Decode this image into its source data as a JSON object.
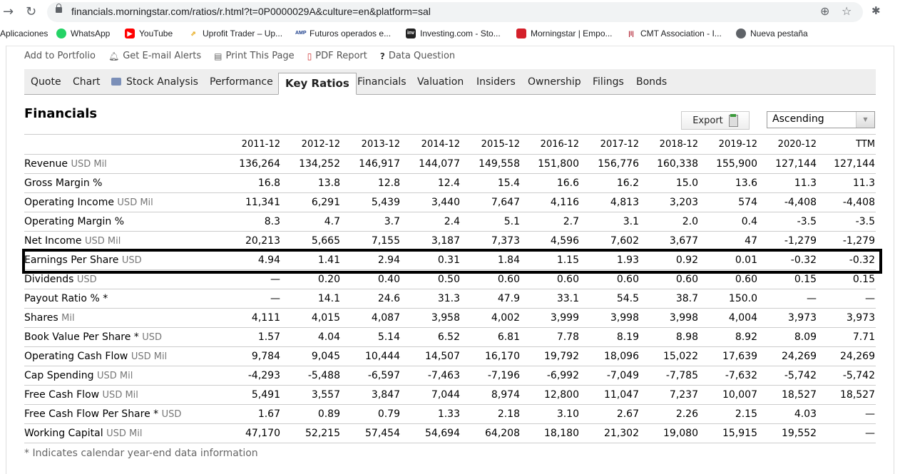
{
  "browser": {
    "url": "financials.morningstar.com/ratios/r.html?t=0P0000029A&culture=en&platform=sal",
    "bookmarks": [
      {
        "label": "Aplicaciones",
        "icon": "apps-icon"
      },
      {
        "label": "WhatsApp",
        "icon": "whatsapp-icon",
        "color": "#25d366"
      },
      {
        "label": "YouTube",
        "icon": "youtube-icon",
        "color": "#ff0000"
      },
      {
        "label": "Uprofit Trader – Up...",
        "icon": "uprofit-icon",
        "color": "#e6a817"
      },
      {
        "label": "Futuros operados e...",
        "icon": "amp-icon",
        "color": "#1d3f8c"
      },
      {
        "label": "Investing.com - Sto...",
        "icon": "investing-icon",
        "color": "#222222"
      },
      {
        "label": "Morningstar | Empo...",
        "icon": "morningstar-icon",
        "color": "#d4202a"
      },
      {
        "label": "CMT Association - I...",
        "icon": "cmt-icon",
        "color": "#b02030"
      },
      {
        "label": "Nueva pestaña",
        "icon": "globe-icon",
        "color": "#5f6368"
      }
    ]
  },
  "utility_links": [
    "Add to Portfolio",
    "Get E-mail Alerts",
    "Print This Page",
    "PDF Report",
    "Data Question"
  ],
  "tabs": [
    {
      "label": "Quote"
    },
    {
      "label": "Chart"
    },
    {
      "label": "Stock Analysis"
    },
    {
      "label": "Performance"
    },
    {
      "label": "Key Ratios",
      "active": true
    },
    {
      "label": "Financials"
    },
    {
      "label": "Valuation"
    },
    {
      "label": "Insiders"
    },
    {
      "label": "Ownership"
    },
    {
      "label": "Filings"
    },
    {
      "label": "Bonds"
    }
  ],
  "section_title": "Financials",
  "export_label": "Export",
  "sort_order": "Ascending",
  "table": {
    "columns": [
      "2011-12",
      "2012-12",
      "2013-12",
      "2014-12",
      "2015-12",
      "2016-12",
      "2017-12",
      "2018-12",
      "2019-12",
      "2020-12",
      "TTM"
    ],
    "rows": [
      {
        "label": "Revenue",
        "unit": "USD Mil",
        "values": [
          "136,264",
          "134,252",
          "146,917",
          "144,077",
          "149,558",
          "151,800",
          "156,776",
          "160,338",
          "155,900",
          "127,144",
          "127,144"
        ]
      },
      {
        "label": "Gross Margin %",
        "unit": "",
        "values": [
          "16.8",
          "13.8",
          "12.8",
          "12.4",
          "15.4",
          "16.6",
          "16.2",
          "15.0",
          "13.6",
          "11.3",
          "11.3"
        ]
      },
      {
        "label": "Operating Income",
        "unit": "USD Mil",
        "values": [
          "11,341",
          "6,291",
          "5,439",
          "3,440",
          "7,647",
          "4,116",
          "4,813",
          "3,203",
          "574",
          "-4,408",
          "-4,408"
        ]
      },
      {
        "label": "Operating Margin %",
        "unit": "",
        "values": [
          "8.3",
          "4.7",
          "3.7",
          "2.4",
          "5.1",
          "2.7",
          "3.1",
          "2.0",
          "0.4",
          "-3.5",
          "-3.5"
        ]
      },
      {
        "label": "Net Income",
        "unit": "USD Mil",
        "values": [
          "20,213",
          "5,665",
          "7,155",
          "3,187",
          "7,373",
          "4,596",
          "7,602",
          "3,677",
          "47",
          "-1,279",
          "-1,279"
        ]
      },
      {
        "label": "Earnings Per Share",
        "unit": "USD",
        "highlighted": true,
        "values": [
          "4.94",
          "1.41",
          "2.94",
          "0.31",
          "1.84",
          "1.15",
          "1.93",
          "0.92",
          "0.01",
          "-0.32",
          "-0.32"
        ]
      },
      {
        "label": "Dividends",
        "unit": "USD",
        "values": [
          "—",
          "0.20",
          "0.40",
          "0.50",
          "0.60",
          "0.60",
          "0.60",
          "0.60",
          "0.60",
          "0.15",
          "0.15"
        ]
      },
      {
        "label": "Payout Ratio % *",
        "unit": "",
        "values": [
          "—",
          "14.1",
          "24.6",
          "31.3",
          "47.9",
          "33.1",
          "54.5",
          "38.7",
          "150.0",
          "—",
          "—"
        ]
      },
      {
        "label": "Shares",
        "unit": "Mil",
        "values": [
          "4,111",
          "4,015",
          "4,087",
          "3,958",
          "4,002",
          "3,999",
          "3,998",
          "3,998",
          "4,004",
          "3,973",
          "3,973"
        ]
      },
      {
        "label": "Book Value Per Share *",
        "unit": "USD",
        "values": [
          "1.57",
          "4.04",
          "5.14",
          "6.52",
          "6.81",
          "7.78",
          "8.19",
          "8.98",
          "8.92",
          "8.09",
          "7.71"
        ]
      },
      {
        "label": "Operating Cash Flow",
        "unit": "USD Mil",
        "values": [
          "9,784",
          "9,045",
          "10,444",
          "14,507",
          "16,170",
          "19,792",
          "18,096",
          "15,022",
          "17,639",
          "24,269",
          "24,269"
        ]
      },
      {
        "label": "Cap Spending",
        "unit": "USD Mil",
        "values": [
          "-4,293",
          "-5,488",
          "-6,597",
          "-7,463",
          "-7,196",
          "-6,992",
          "-7,049",
          "-7,785",
          "-7,632",
          "-5,742",
          "-5,742"
        ]
      },
      {
        "label": "Free Cash Flow",
        "unit": "USD Mil",
        "values": [
          "5,491",
          "3,557",
          "3,847",
          "7,044",
          "8,974",
          "12,800",
          "11,047",
          "7,237",
          "10,007",
          "18,527",
          "18,527"
        ]
      },
      {
        "label": "Free Cash Flow Per Share *",
        "unit": "USD",
        "values": [
          "1.67",
          "0.89",
          "0.79",
          "1.33",
          "2.18",
          "3.10",
          "2.67",
          "2.26",
          "2.15",
          "4.03",
          "—"
        ]
      },
      {
        "label": "Working Capital",
        "unit": "USD Mil",
        "values": [
          "47,170",
          "52,215",
          "57,454",
          "54,694",
          "64,208",
          "18,180",
          "21,302",
          "19,080",
          "15,915",
          "19,552",
          "—"
        ]
      }
    ]
  },
  "footnote": "* Indicates calendar year-end data information"
}
